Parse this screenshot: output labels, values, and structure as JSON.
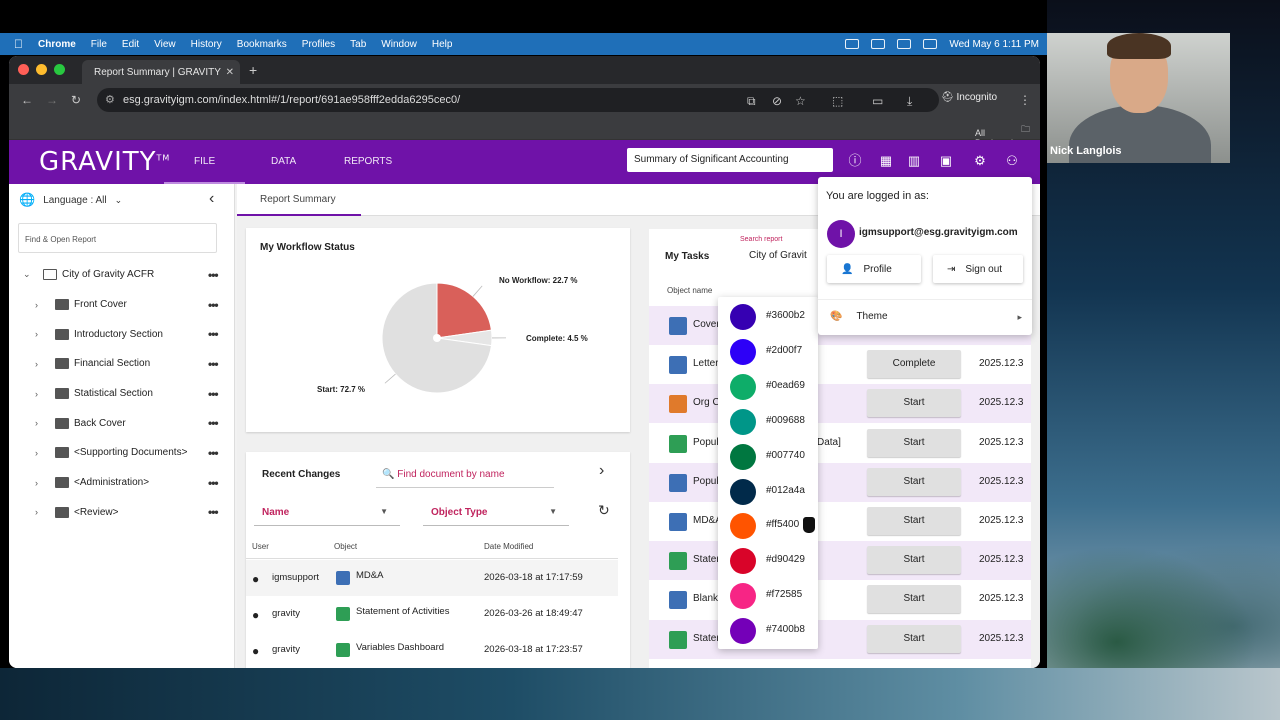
{
  "menubar": {
    "apple": "",
    "app": "Chrome",
    "items": [
      "File",
      "Edit",
      "View",
      "History",
      "Bookmarks",
      "Profiles",
      "Tab",
      "Window",
      "Help"
    ],
    "clock": "Wed May 6  1:11 PM"
  },
  "browser": {
    "tab_title": "Report Summary | GRAVITY",
    "url": "esg.gravityigm.com/index.html#/1/report/691ae958fff2edda6295cec0/",
    "incognito": "Incognito",
    "bookmarks_label": "All Bookmarks"
  },
  "app": {
    "logo": "GRAVITY",
    "logo_tm": "TM",
    "nav": [
      "FILE",
      "DATA",
      "REPORTS"
    ],
    "search_value": "Summary of Significant Accounting",
    "accent": "#6f12a8"
  },
  "sidebar": {
    "language": "Language : All",
    "find_placeholder": "Find & Open Report",
    "root": "City of Gravity ACFR",
    "items": [
      "Front Cover",
      "Introductory Section",
      "Financial Section",
      "Statistical Section",
      "Back Cover",
      "<Supporting Documents>",
      "<Administration>",
      "<Review>"
    ]
  },
  "report_tab": "Report Summary",
  "workflow": {
    "title": "My Workflow Status",
    "labels": [
      "No Workflow: 22.7 %",
      "Complete: 4.5 %",
      "Start: 72.7 %"
    ]
  },
  "chart_data": {
    "type": "pie",
    "title": "My Workflow Status",
    "categories": [
      "No Workflow",
      "Complete",
      "Start"
    ],
    "values": [
      22.7,
      4.5,
      72.7
    ],
    "colors": [
      "#d9605a",
      "#e6e6e6",
      "#e0e0e0"
    ]
  },
  "recent": {
    "title": "Recent Changes",
    "search_placeholder": "Find document by name",
    "filter_name": "Name",
    "filter_type": "Object Type",
    "headers": [
      "User",
      "Object",
      "Date Modified"
    ],
    "rows": [
      {
        "user": "igmsupport",
        "object": "MD&A",
        "date": "2026-03-18 at 17:17:59"
      },
      {
        "user": "gravity",
        "object": "Statement of Activities",
        "date": "2026-03-26 at 18:49:47"
      },
      {
        "user": "gravity",
        "object": "Variables Dashboard",
        "date": "2026-03-18 at 17:23:57"
      }
    ]
  },
  "tasks": {
    "title": "My Tasks",
    "search_label": "Search report",
    "search_value": "City of Gravit",
    "col_object": "Object name",
    "rows": [
      {
        "name": "Cover",
        "action": "",
        "date": ""
      },
      {
        "name": "Letter",
        "action": "Complete",
        "date": "2025.12.3"
      },
      {
        "name": "Org C",
        "action": "Start",
        "date": "2025.12.3"
      },
      {
        "name": "Popul",
        "extra": "Data]",
        "action": "Start",
        "date": "2025.12.3"
      },
      {
        "name": "Popul",
        "action": "Start",
        "date": "2025.12.3"
      },
      {
        "name": "MD&A",
        "action": "Start",
        "date": "2025.12.3"
      },
      {
        "name": "Stater",
        "action": "Start",
        "date": "2025.12.3"
      },
      {
        "name": "Blank",
        "action": "Start",
        "date": "2025.12.3"
      },
      {
        "name": "Stater",
        "action": "Start",
        "date": "2025.12.3"
      }
    ]
  },
  "palette": [
    "#3600b2",
    "#2d00f7",
    "#0ead69",
    "#009688",
    "#007740",
    "#012a4a",
    "#ff5400",
    "#d90429",
    "#f72585",
    "#7400b8"
  ],
  "account": {
    "header": "You are logged in as:",
    "avatar_letter": "I",
    "email": "igmsupport@esg.gravityigm.com",
    "profile": "Profile",
    "signout": "Sign out",
    "theme": "Theme"
  },
  "webcam": {
    "name": "Nick Langlois"
  }
}
